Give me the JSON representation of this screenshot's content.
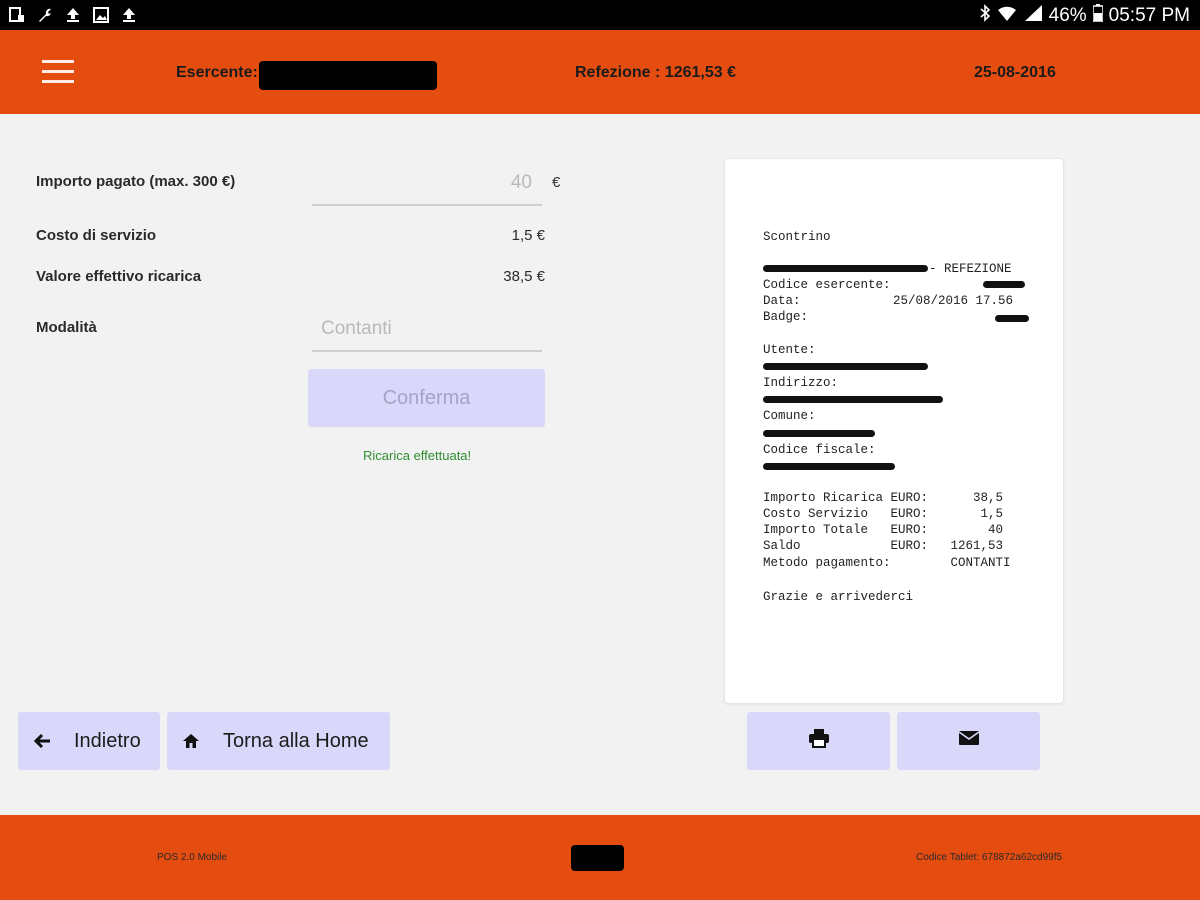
{
  "status_bar": {
    "battery": "46%",
    "time": "05:57 PM",
    "left_icons": [
      "screen-icon",
      "wrench-icon",
      "upload-icon",
      "image-icon",
      "upload-icon"
    ]
  },
  "header": {
    "merchant_label": "Esercente:",
    "refezione": "Refezione : 1261,53 €",
    "date": "25-08-2016"
  },
  "form": {
    "amount_label": "Importo pagato  (max. 300 €)",
    "amount_value": "40",
    "currency": "€",
    "service_cost_label": "Costo di servizio",
    "service_cost_value": "1,5 €",
    "effective_label": "Valore effettivo ricarica",
    "effective_value": "38,5 €",
    "mode_label": "Modalità",
    "mode_value": "Contanti",
    "confirm_label": "Conferma",
    "success_message": "Ricarica effettuata!"
  },
  "nav": {
    "back_label": "Indietro",
    "home_label": "Torna alla Home"
  },
  "receipt": {
    "title": "Scontrino",
    "service_suffix": "- REFEZIONE",
    "merchant_code_label": "Codice esercente:",
    "date_label": "Data:",
    "date_value": "25/08/2016 17.56",
    "badge_label": "Badge:",
    "user_label": "Utente:",
    "address_label": "Indirizzo:",
    "city_label": "Comune:",
    "tax_code_label": "Codice fiscale:",
    "line_recharge": "Importo Ricarica EURO:      38,5",
    "line_service": "Costo Servizio   EURO:       1,5",
    "line_total": "Importo Totale   EURO:        40",
    "line_balance": "Saldo            EURO:   1261,53",
    "line_method": "Metodo pagamento:        CONTANTI",
    "farewell": "Grazie e arrivederci"
  },
  "footer": {
    "app_version": "POS 2.0 Mobile",
    "tablet_code": "Codice Tablet: 678872a62cd99f5"
  },
  "colors": {
    "brand_orange": "#e54d10",
    "button_lavender": "#d9d7fa",
    "success_green": "#2f8d2f"
  }
}
